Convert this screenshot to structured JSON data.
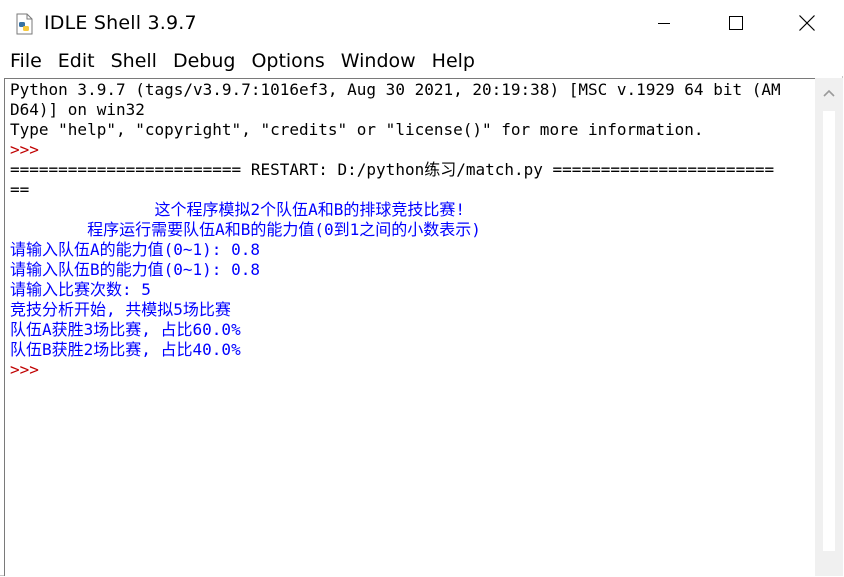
{
  "window": {
    "title": "IDLE Shell 3.9.7"
  },
  "menu": [
    "File",
    "Edit",
    "Shell",
    "Debug",
    "Options",
    "Window",
    "Help"
  ],
  "colors": {
    "stdout": "#0000ff",
    "prompt": "#c00000",
    "text": "#000000"
  },
  "shell": {
    "lines": [
      "Python 3.9.7 (tags/v3.9.7:1016ef3, Aug 30 2021, 20:19:38) [MSC v.1929 64 bit (AM",
      "D64)] on win32",
      "Type \"help\", \"copyright\", \"credits\" or \"license()\" for more information.",
      ">>>",
      "======================== RESTART: D:/python练习/match.py =======================",
      "==",
      "               这个程序模拟2个队伍A和B的排球竞技比赛!",
      "        程序运行需要队伍A和B的能力值(0到1之间的小数表示)",
      "请输入队伍A的能力值(0~1): 0.8",
      "请输入队伍B的能力值(0~1): 0.8",
      "请输入比赛次数: 5",
      "竞技分析开始, 共模拟5场比赛",
      "队伍A获胜3场比赛, 占比60.0%",
      "队伍B获胜2场比赛, 占比40.0%",
      ">>>"
    ]
  }
}
